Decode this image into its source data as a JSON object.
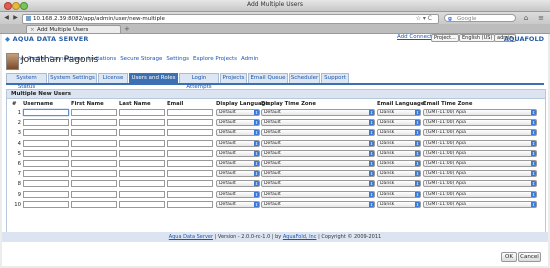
{
  "window": {
    "title": "Add Multiple Users"
  },
  "browser": {
    "url": "10.168.2.39:8082/app/admin/user/new-multiple",
    "search_placeholder": "Google",
    "tab_title": "Add Multiple Users"
  },
  "header": {
    "logo_left": "AQUA DATA SERVER",
    "logo_right": "AQUAFOLD",
    "add_connections": "Add Connections",
    "project_select": "Project...",
    "language_select": "English (US)",
    "user_select": "admin"
  },
  "menu": [
    "Home",
    "Profile",
    "Connections",
    "Invitations",
    "Secure Storage",
    "Settings",
    "Explore Projects",
    "Admin"
  ],
  "user": {
    "name": "Jonathan Pagonis"
  },
  "tabs": [
    {
      "label": "System Status",
      "active": false
    },
    {
      "label": "System Settings",
      "active": false
    },
    {
      "label": "License",
      "active": false
    },
    {
      "label": "Users and Roles",
      "active": true
    },
    {
      "label": "Login Attempts",
      "active": false
    },
    {
      "label": "Projects",
      "active": false
    },
    {
      "label": "Email Queue",
      "active": false
    },
    {
      "label": "Scheduler",
      "active": false
    },
    {
      "label": "Support",
      "active": false
    }
  ],
  "panel": {
    "title": "Multiple New Users"
  },
  "columns": {
    "num": "#",
    "username": "Username",
    "first_name": "First Name",
    "last_name": "Last Name",
    "email": "Email",
    "display_language": "Display Language",
    "display_time_zone": "Display Time Zone",
    "email_language": "Email Language",
    "email_time_zone": "Email Time Zone"
  },
  "rows": [
    {
      "num": "1",
      "display_language": "Default",
      "display_time_zone": "Default",
      "email_language": "Dansk",
      "email_time_zone": "(GMT-11:00) Apia"
    },
    {
      "num": "2",
      "display_language": "Default",
      "display_time_zone": "Default",
      "email_language": "Dansk",
      "email_time_zone": "(GMT-11:00) Apia"
    },
    {
      "num": "3",
      "display_language": "Default",
      "display_time_zone": "Default",
      "email_language": "Dansk",
      "email_time_zone": "(GMT-11:00) Apia"
    },
    {
      "num": "4",
      "display_language": "Default",
      "display_time_zone": "Default",
      "email_language": "Dansk",
      "email_time_zone": "(GMT-11:00) Apia"
    },
    {
      "num": "5",
      "display_language": "Default",
      "display_time_zone": "Default",
      "email_language": "Dansk",
      "email_time_zone": "(GMT-11:00) Apia"
    },
    {
      "num": "6",
      "display_language": "Default",
      "display_time_zone": "Default",
      "email_language": "Dansk",
      "email_time_zone": "(GMT-11:00) Apia"
    },
    {
      "num": "7",
      "display_language": "Default",
      "display_time_zone": "Default",
      "email_language": "Dansk",
      "email_time_zone": "(GMT-11:00) Apia"
    },
    {
      "num": "8",
      "display_language": "Default",
      "display_time_zone": "Default",
      "email_language": "Dansk",
      "email_time_zone": "(GMT-11:00) Apia"
    },
    {
      "num": "9",
      "display_language": "Default",
      "display_time_zone": "Default",
      "email_language": "Dansk",
      "email_time_zone": "(GMT-11:00) Apia"
    },
    {
      "num": "10",
      "display_language": "Default",
      "display_time_zone": "Default",
      "email_language": "Dansk",
      "email_time_zone": "(GMT-11:00) Apia"
    }
  ],
  "buttons": {
    "ok": "OK",
    "cancel": "Cancel"
  },
  "footer": {
    "product_link": "Aqua Data Server",
    "version_text": " | Version - 2.0.0-rc-1.0 | by ",
    "company_link": "AquaFold, Inc",
    "copyright": " | Copyright © 2009-2011"
  },
  "colors": {
    "accent": "#3d6fb3",
    "link": "#1a55b0",
    "panel_header": "#dbe4f0"
  }
}
